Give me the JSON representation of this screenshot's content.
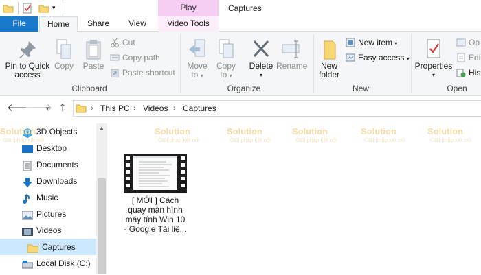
{
  "window": {
    "title": "Captures",
    "context_tab": "Play"
  },
  "tabs": {
    "file": "File",
    "home": "Home",
    "share": "Share",
    "view": "View",
    "video_tools": "Video Tools"
  },
  "ribbon": {
    "clipboard": {
      "label": "Clipboard",
      "pin_line1": "Pin to Quick",
      "pin_line2": "access",
      "copy": "Copy",
      "paste": "Paste",
      "cut": "Cut",
      "copy_path": "Copy path",
      "paste_shortcut": "Paste shortcut"
    },
    "organize": {
      "label": "Organize",
      "move_line1": "Move",
      "move_line2": "to",
      "copy_line1": "Copy",
      "copy_line2": "to",
      "delete": "Delete",
      "rename": "Rename"
    },
    "new": {
      "label": "New",
      "folder_line1": "New",
      "folder_line2": "folder",
      "new_item": "New item",
      "easy_access": "Easy access"
    },
    "open": {
      "label": "Open",
      "properties": "Properties",
      "open_trunc": "Op",
      "edit_trunc": "Edi",
      "history_trunc": "His"
    }
  },
  "address": {
    "crumbs": [
      "This PC",
      "Videos",
      "Captures"
    ]
  },
  "nav_pane": {
    "items": [
      {
        "label": "3D Objects",
        "icon": "cube-icon"
      },
      {
        "label": "Desktop",
        "icon": "desktop-icon"
      },
      {
        "label": "Documents",
        "icon": "documents-icon"
      },
      {
        "label": "Downloads",
        "icon": "download-icon"
      },
      {
        "label": "Music",
        "icon": "music-icon"
      },
      {
        "label": "Pictures",
        "icon": "pictures-icon"
      },
      {
        "label": "Videos",
        "icon": "videos-icon"
      },
      {
        "label": "Captures",
        "icon": "folder-icon"
      },
      {
        "label": "Local Disk (C:)",
        "icon": "disk-icon"
      }
    ]
  },
  "files": [
    {
      "name_line1": "[ MỚI ] Cách",
      "name_line2": "quay màn hình",
      "name_line3": "máy tính Win 10",
      "name_line4": "- Google Tài liệ..."
    }
  ],
  "watermark": {
    "brand": "Solution",
    "tagline": "Giải pháp kết nối"
  },
  "colors": {
    "file_tab": "#1979ca",
    "context_tab": "#f5ccf2",
    "selection": "#cce8ff",
    "folder": "#f8d775"
  }
}
